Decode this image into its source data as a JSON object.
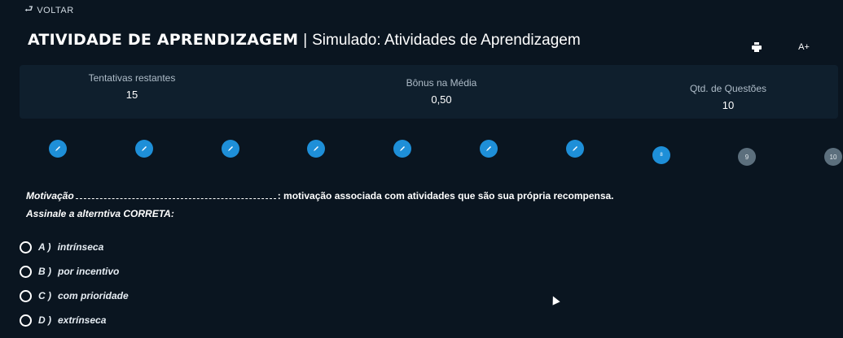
{
  "nav": {
    "back_label": "VOLTAR",
    "back_icon": "return-arrow-icon"
  },
  "header": {
    "title": "ATIVIDADE DE APRENDIZAGEM",
    "separator": "|",
    "subtitle": "Simulado: Atividades de Aprendizagem",
    "print_icon": "print-icon",
    "font_size_label": "A+"
  },
  "stats": {
    "attempts": {
      "label": "Tentativas restantes",
      "value": "15"
    },
    "bonus": {
      "label": "Bônus na Média",
      "value": "0,50"
    },
    "questions": {
      "label": "Qtd. de Questões",
      "value": "10"
    }
  },
  "question_nav": [
    {
      "label": "",
      "state": "answered",
      "icon": "pencil-icon"
    },
    {
      "label": "",
      "state": "answered",
      "icon": "pencil-icon"
    },
    {
      "label": "",
      "state": "answered",
      "icon": "pencil-icon"
    },
    {
      "label": "",
      "state": "answered",
      "icon": "pencil-icon"
    },
    {
      "label": "",
      "state": "answered",
      "icon": "pencil-icon"
    },
    {
      "label": "",
      "state": "answered",
      "icon": "pencil-icon"
    },
    {
      "label": "",
      "state": "answered",
      "icon": "pencil-icon"
    },
    {
      "label": "8",
      "state": "current"
    },
    {
      "label": "9",
      "state": "pending"
    },
    {
      "label": "10",
      "state": "pending"
    }
  ],
  "question": {
    "term": "Motivação",
    "rest": ": motivação associada com atividades que são sua própria recompensa.",
    "instruction": "Assinale a alterntiva CORRETA:"
  },
  "options": [
    {
      "letter": "A )",
      "text": "intrínseca"
    },
    {
      "letter": "B )",
      "text": "por incentivo"
    },
    {
      "letter": "C )",
      "text": "com prioridade"
    },
    {
      "letter": "D )",
      "text": "extrínseca"
    }
  ],
  "colors": {
    "background": "#0a1520",
    "panel": "#0f1f2d",
    "answered": "#1e8fd8",
    "pending": "#5c6f7d"
  }
}
